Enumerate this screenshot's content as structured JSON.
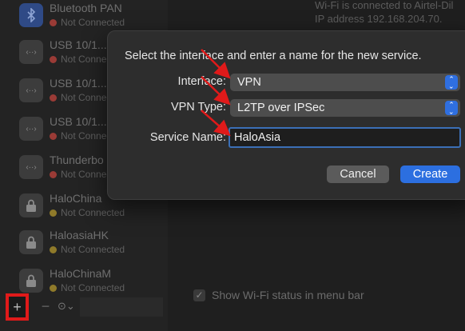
{
  "top_info": {
    "line1": "Wi-Fi is connected to Airtel-Dil",
    "line2": "IP address 192.168.204.70."
  },
  "sidebar": {
    "items": [
      {
        "name": "Bluetooth PAN",
        "status": "Not Connected",
        "status_color": "red",
        "icon": "bluetooth-icon"
      },
      {
        "name": "USB 10/1...",
        "status": "Not Connected",
        "status_color": "red",
        "icon": "ethernet-icon"
      },
      {
        "name": "USB 10/1...",
        "status": "Not Connected",
        "status_color": "red",
        "icon": "ethernet-icon"
      },
      {
        "name": "USB 10/1...",
        "status": "Not Connected",
        "status_color": "red",
        "icon": "ethernet-icon"
      },
      {
        "name": "Thunderbo",
        "status": "Not Connected",
        "status_color": "red",
        "icon": "ethernet-icon"
      },
      {
        "name": "HaloChina",
        "status": "Not Connected",
        "status_color": "yellow",
        "icon": "lock-icon"
      },
      {
        "name": "HaloasiaHK",
        "status": "Not Connected",
        "status_color": "yellow",
        "icon": "lock-icon"
      },
      {
        "name": "HaloChinaM",
        "status": "Not Connected",
        "status_color": "yellow",
        "icon": "lock-icon"
      }
    ],
    "toolbar": {
      "add_label": "+",
      "remove_label": "−",
      "action_label": "⊙⌄"
    }
  },
  "dialog": {
    "title": "Select the interface and enter a name for the new service.",
    "interface_label": "Interface:",
    "interface_value": "VPN",
    "vpn_type_label": "VPN Type:",
    "vpn_type_value": "L2TP over IPSec",
    "service_name_label": "Service Name:",
    "service_name_value": "HaloAsia",
    "cancel_label": "Cancel",
    "create_label": "Create"
  },
  "wifi_menu": {
    "label": "Show Wi-Fi status in menu bar",
    "checked": true
  },
  "colors": {
    "accent": "#2c6fe0",
    "annotation": "#e01a1a",
    "status_red": "#9a3b36",
    "status_yellow": "#8f7a2a"
  }
}
